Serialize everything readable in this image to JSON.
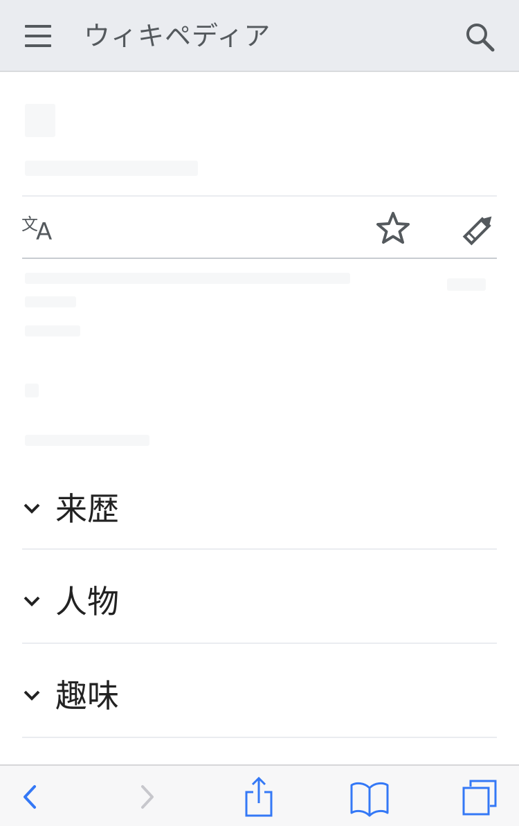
{
  "header": {
    "wordmark": "ウィキペディア",
    "menu_icon": "hamburger-menu-icon",
    "search_icon": "search-icon"
  },
  "page_actions": {
    "language_icon": "language-translate-icon",
    "watch_icon": "star-icon",
    "edit_icon": "pencil-icon"
  },
  "sections": [
    {
      "title": "来歴",
      "icon": "chevron-down-icon"
    },
    {
      "title": "人物",
      "icon": "chevron-down-icon"
    },
    {
      "title": "趣味",
      "icon": "chevron-down-icon"
    }
  ],
  "toolbar": {
    "back_icon": "back-chevron-icon",
    "forward_icon": "forward-chevron-icon",
    "share_icon": "share-icon",
    "bookmarks_icon": "bookmarks-book-icon",
    "tabs_icon": "tabs-icon"
  },
  "colors": {
    "header_bg": "#eaecf0",
    "icon_gray": "#54595d",
    "text": "#222222",
    "safari_blue": "#3478f6",
    "disabled": "#c7c7cc"
  }
}
